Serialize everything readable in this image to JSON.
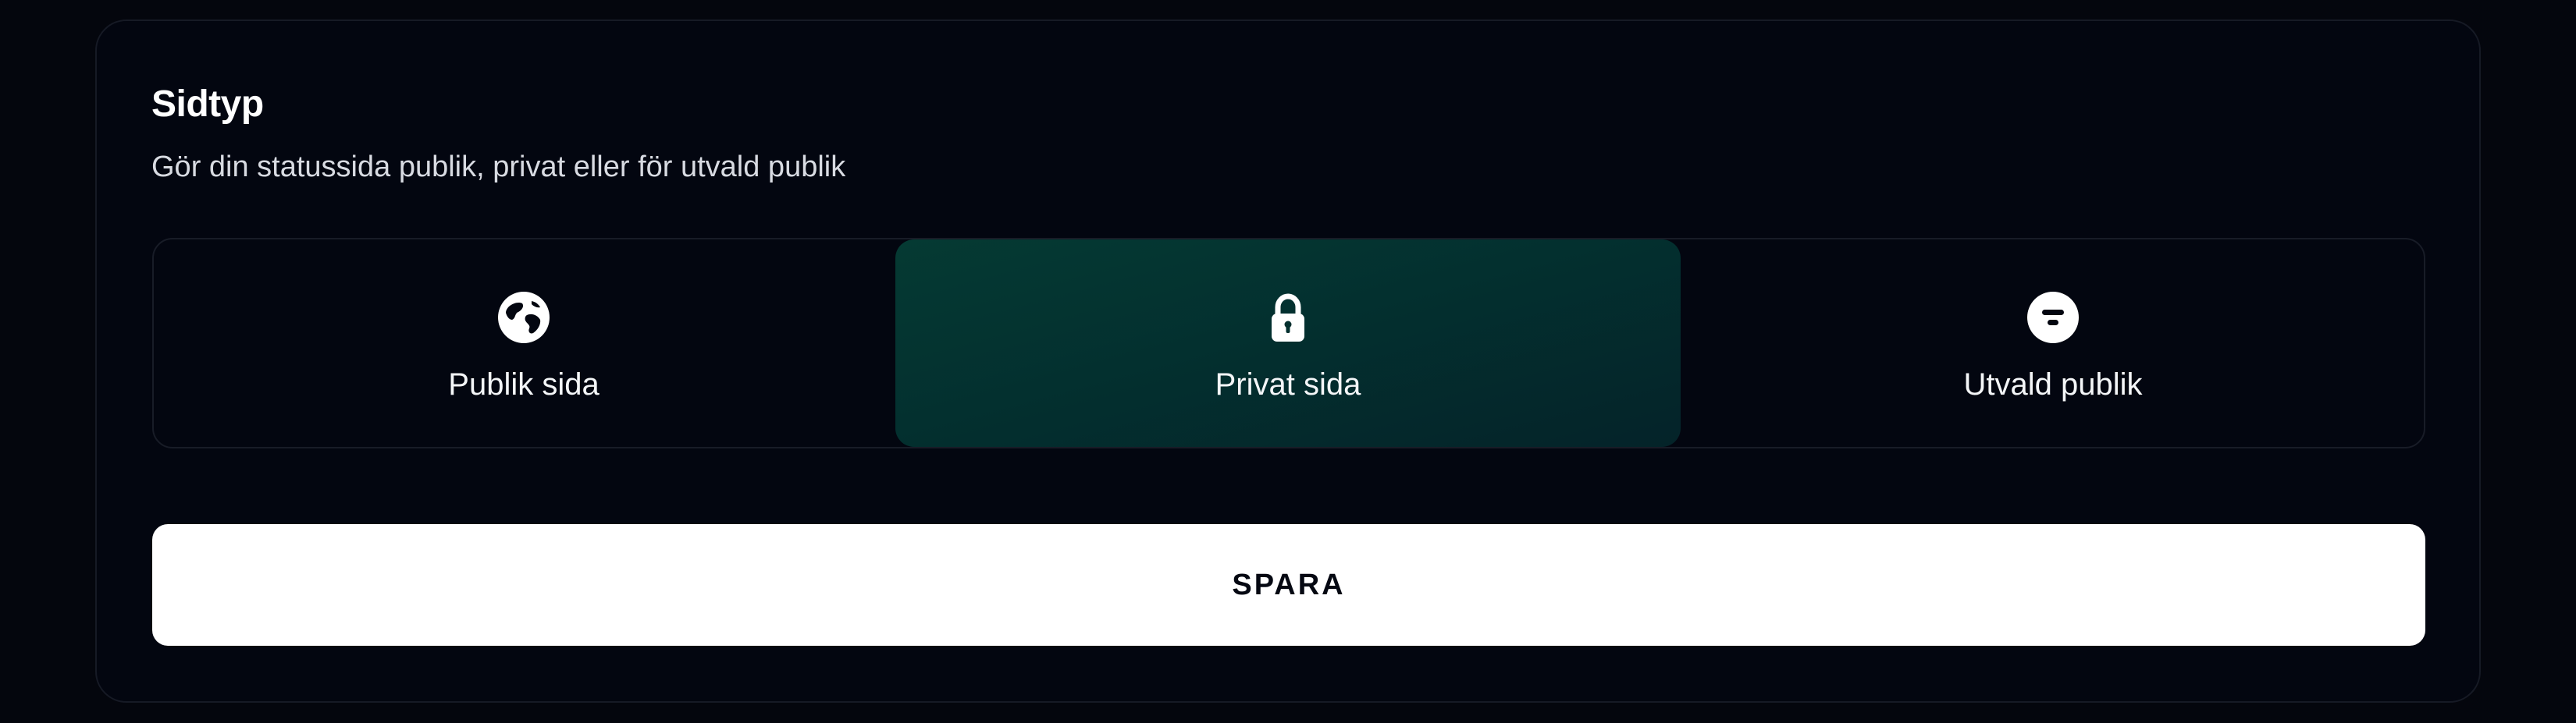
{
  "section": {
    "title": "Sidtyp",
    "subtitle": "Gör din statussida publik, privat eller för utvald publik"
  },
  "page_type_options": [
    {
      "label": "Publik sida",
      "icon": "globe-icon",
      "selected": false
    },
    {
      "label": "Privat sida",
      "icon": "lock-icon",
      "selected": true
    },
    {
      "label": "Utvald publik",
      "icon": "filter-icon",
      "selected": false
    }
  ],
  "save_button": {
    "label": "SPARA"
  },
  "colors": {
    "background": "#04060d",
    "selected_option": "#053a33",
    "button_background": "#ffffff",
    "button_text": "#050812"
  }
}
